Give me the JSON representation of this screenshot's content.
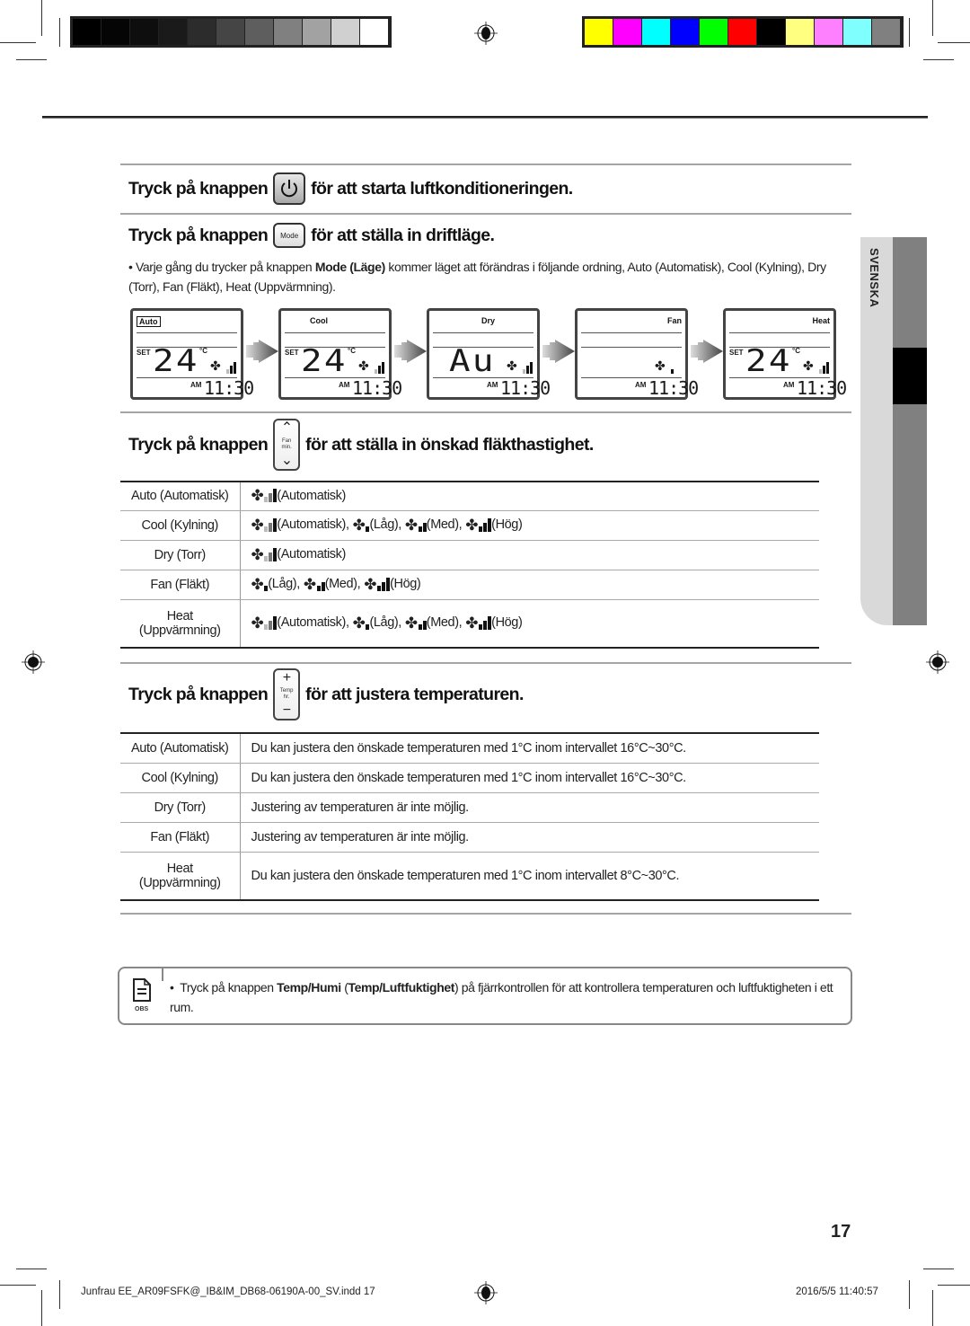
{
  "print_marks": {
    "gray_swatches": [
      "#000000",
      "#050505",
      "#0e0e0e",
      "#1a1a1a",
      "#2c2c2c",
      "#454545",
      "#5e5e5e",
      "#808080",
      "#a2a2a2",
      "#d0d0d0",
      "#ffffff"
    ],
    "color_swatches": [
      "#ffff00",
      "#ff00ff",
      "#00ffff",
      "#0000ff",
      "#00ff00",
      "#ff0000",
      "#000000",
      "#ffff80",
      "#ff80ff",
      "#80ffff",
      "#808080"
    ]
  },
  "side_tab": {
    "label": "SVENSKA"
  },
  "section_power": {
    "prefix": "Tryck på knappen",
    "button_icon": "power-icon",
    "suffix": "för att starta luftkonditioneringen."
  },
  "section_mode": {
    "prefix": "Tryck på knappen",
    "button_label": "Mode",
    "suffix": "för att ställa in driftläge.",
    "bullet": "•",
    "text_before": "Varje gång du trycker på knappen ",
    "text_bold": "Mode (Läge)",
    "text_after": " kommer läget att förändras i följande ordning, Auto (Automatisk), Cool (Kylning), Dry (Torr), Fan (Fläkt), Heat (Uppvärmning).",
    "displays": [
      {
        "mode": "Auto",
        "boxed": true,
        "set": "SET",
        "temp": "24",
        "unit": "°C",
        "fan_level": "auto",
        "am": "AM",
        "time": "11:30"
      },
      {
        "mode": "Cool",
        "boxed": false,
        "set": "SET",
        "temp": "24",
        "unit": "°C",
        "fan_level": "auto",
        "am": "AM",
        "time": "11:30"
      },
      {
        "mode": "Dry",
        "boxed": false,
        "set": "",
        "temp": "Au",
        "unit": "",
        "fan_level": "auto",
        "am": "AM",
        "time": "11:30"
      },
      {
        "mode": "Fan",
        "boxed": false,
        "set": "",
        "temp": "",
        "unit": "",
        "fan_level": "low",
        "am": "AM",
        "time": "11:30"
      },
      {
        "mode": "Heat",
        "boxed": false,
        "set": "SET",
        "temp": "24",
        "unit": "°C",
        "fan_level": "auto",
        "am": "AM",
        "time": "11:30"
      }
    ]
  },
  "section_fan": {
    "prefix": "Tryck på knappen",
    "button_top": "^",
    "button_label_1": "Fan",
    "button_label_2": "min.",
    "button_bottom": "v",
    "suffix": "för att ställa in önskad fläkthastighet.",
    "rows": [
      {
        "mode": "Auto (Automatisk)",
        "options": [
          {
            "level": "auto",
            "label": "(Automatisk)"
          }
        ]
      },
      {
        "mode": "Cool (Kylning)",
        "options": [
          {
            "level": "auto",
            "label": "(Automatisk),"
          },
          {
            "level": "low",
            "label": "(Låg),"
          },
          {
            "level": "med",
            "label": "(Med),"
          },
          {
            "level": "high",
            "label": "(Hög)"
          }
        ]
      },
      {
        "mode": "Dry (Torr)",
        "options": [
          {
            "level": "auto",
            "label": "(Automatisk)"
          }
        ]
      },
      {
        "mode": "Fan (Fläkt)",
        "options": [
          {
            "level": "low",
            "label": "(Låg),"
          },
          {
            "level": "med",
            "label": "(Med),"
          },
          {
            "level": "high",
            "label": "(Hög)"
          }
        ]
      },
      {
        "mode": "Heat (Uppvärmning)",
        "mode_line1": "Heat",
        "mode_line2": "(Uppvärmning)",
        "options": [
          {
            "level": "auto",
            "label": "(Automatisk),"
          },
          {
            "level": "low",
            "label": "(Låg),"
          },
          {
            "level": "med",
            "label": "(Med),"
          },
          {
            "level": "high",
            "label": "(Hög)"
          }
        ]
      }
    ]
  },
  "section_temp": {
    "prefix": "Tryck på knappen",
    "button_top": "+",
    "button_label_1": "Temp",
    "button_label_2": "hr.",
    "button_bottom": "−",
    "suffix": "för att justera temperaturen.",
    "rows": [
      {
        "mode": "Auto (Automatisk)",
        "text": "Du kan justera den önskade temperaturen med 1°C inom intervallet 16°C~30°C."
      },
      {
        "mode": "Cool (Kylning)",
        "text": "Du kan justera den önskade temperaturen med 1°C inom intervallet 16°C~30°C."
      },
      {
        "mode": "Dry (Torr)",
        "text": "Justering av temperaturen är inte möjlig."
      },
      {
        "mode": "Fan (Fläkt)",
        "text": "Justering av temperaturen är inte möjlig."
      },
      {
        "mode": "Heat (Uppvärmning)",
        "mode_line1": "Heat",
        "mode_line2": "(Uppvärmning)",
        "text": "Du kan justera den önskade temperaturen med 1°C inom intervallet 8°C~30°C."
      }
    ]
  },
  "note": {
    "icon": "note-icon",
    "icon_label": "OBS",
    "bullet": "•",
    "text_before": "Tryck på knappen ",
    "bold_1": "Temp/Humi",
    "text_mid_1": " (",
    "bold_2": "Temp/Luftfuktighet",
    "text_after": ") på fjärrkontrollen för att kontrollera temperaturen och luftfuktigheten i ett rum."
  },
  "page_number": "17",
  "footer": {
    "file": "Junfrau EE_AR09FSFK@_IB&IM_DB68-06190A-00_SV.indd   17",
    "timestamp": "2016/5/5   11:40:57"
  }
}
